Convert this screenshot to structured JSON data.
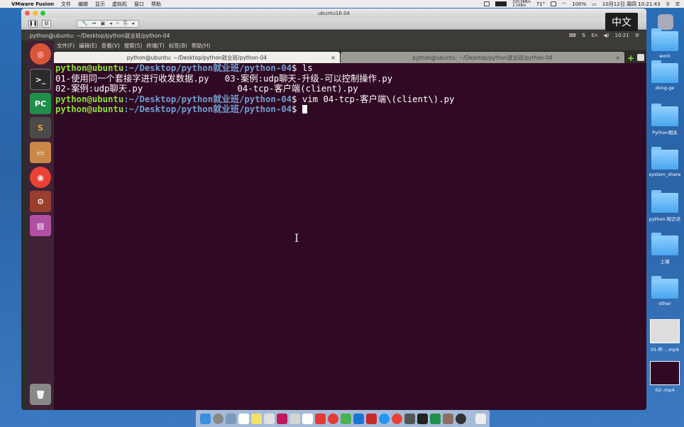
{
  "mac_menubar": {
    "app_name": "VMware Fusion",
    "menus": [
      "文件",
      "编辑",
      "显示",
      "虚拟机",
      "窗口",
      "帮助"
    ],
    "temp": "71°",
    "net_speed": "320.0KB/s\n2.1KB/s",
    "battery": "100%",
    "datetime": "10月12日 周四  10:21:43"
  },
  "vmware": {
    "window_title": "ubuntu16.04"
  },
  "ubuntu": {
    "topbar_title": "python@ubuntu: ~/Desktop/python就业班/python-04",
    "clock": "10:21"
  },
  "terminal": {
    "menu": [
      "文件(F)",
      "编辑(E)",
      "查看(V)",
      "搜索(S)",
      "终端(T)",
      "标签(B)",
      "帮助(H)"
    ],
    "tabs": [
      {
        "title": "python@ubuntu: ~/Desktop/python就业班/python-04",
        "active": true
      },
      {
        "title": "python@ubuntu: ~/Desktop/python就业班/python-04",
        "active": false
      }
    ],
    "prompt_user": "python@ubuntu",
    "prompt_path": ":~/Desktop/python就业班/python-04",
    "lines": [
      {
        "cmd": " ls"
      },
      {
        "out": "01-使用同一个套接字进行收发数据.py   03-案例:udp聊天-升级-可以控制操作.py"
      },
      {
        "out": "02-案例:udp聊天.py                  04-tcp-客户端(client).py"
      },
      {
        "cmd": " vim 04-tcp-客户端\\(client\\).py"
      },
      {
        "cmd": " "
      }
    ]
  },
  "ime": {
    "label": "中文"
  },
  "desktop_icons": [
    {
      "label": "work",
      "type": "folder"
    },
    {
      "label": "dong-ge",
      "type": "folder"
    },
    {
      "label": "Python相关",
      "type": "folder"
    },
    {
      "label": "system_share",
      "type": "folder"
    },
    {
      "label": "python-知识点",
      "type": "folder"
    },
    {
      "label": "上课",
      "type": "folder"
    },
    {
      "label": "other",
      "type": "folder"
    },
    {
      "label": "01-昨....mp4",
      "type": "video"
    },
    {
      "label": "02-.mp4",
      "type": "video"
    }
  ],
  "colors": {
    "terminal_bg": "#300a24",
    "prompt_user": "#8ae234",
    "prompt_path": "#729fcf"
  }
}
